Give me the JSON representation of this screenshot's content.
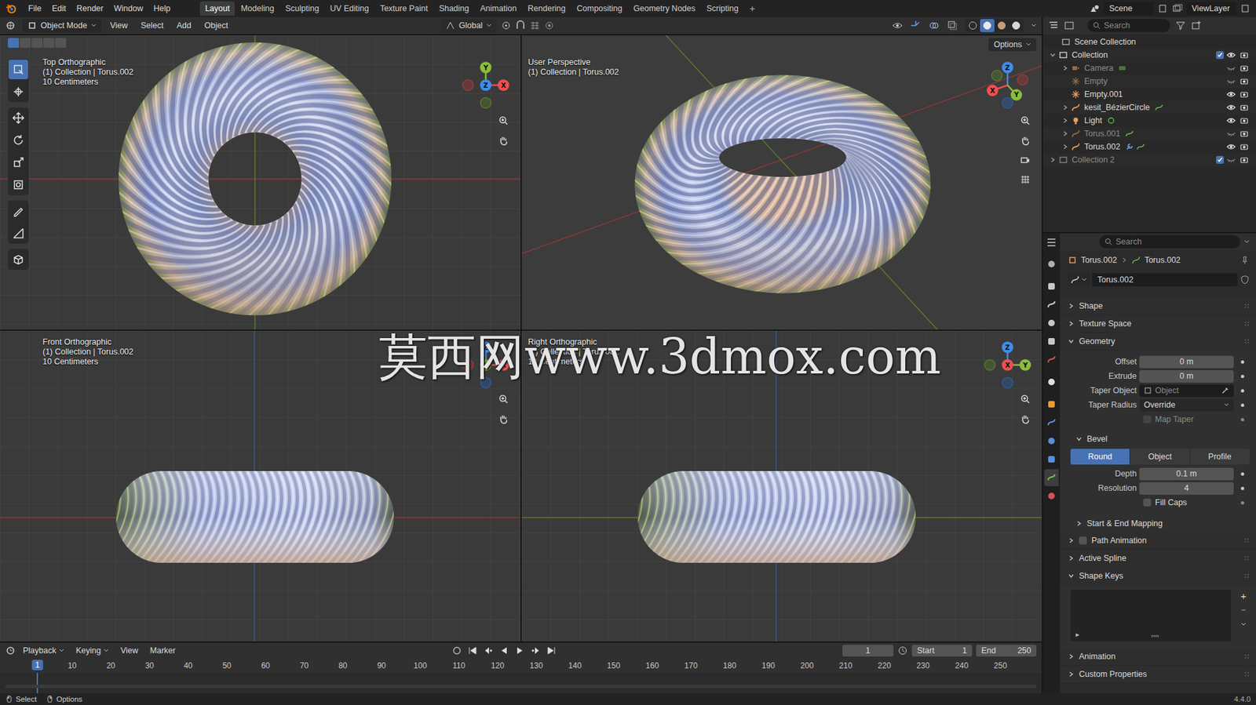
{
  "topbar": {
    "menus": [
      "File",
      "Edit",
      "Render",
      "Window",
      "Help"
    ],
    "workspaces": [
      {
        "label": "Layout",
        "selected": true
      },
      {
        "label": "Modeling",
        "selected": false
      },
      {
        "label": "Sculpting",
        "selected": false
      },
      {
        "label": "UV Editing",
        "selected": false
      },
      {
        "label": "Texture Paint",
        "selected": false
      },
      {
        "label": "Shading",
        "selected": false
      },
      {
        "label": "Animation",
        "selected": false
      },
      {
        "label": "Rendering",
        "selected": false
      },
      {
        "label": "Compositing",
        "selected": false
      },
      {
        "label": "Geometry Nodes",
        "selected": false
      },
      {
        "label": "Scripting",
        "selected": false
      }
    ],
    "add_workspace": "+",
    "scene": "Scene",
    "view_layer": "ViewLayer"
  },
  "viewport_header": {
    "mode": "Object Mode",
    "menus": [
      "View",
      "Select",
      "Add",
      "Object"
    ],
    "orientation": "Global",
    "options": "Options",
    "shading": [
      {
        "selected": false
      },
      {
        "selected": true
      },
      {
        "selected": false
      },
      {
        "selected": false
      }
    ]
  },
  "toolbar": [
    {
      "selected": true
    },
    {
      "selected": false
    },
    {
      "selected": false
    },
    {
      "selected": false
    },
    {
      "selected": false
    },
    {
      "selected": false
    },
    {
      "selected": false
    },
    {
      "selected": false
    },
    {
      "selected": false
    }
  ],
  "viewports": [
    {
      "kind": "top",
      "title": "Top Orthographic",
      "context": "(1) Collection | Torus.002",
      "scale": "10 Centimeters",
      "gizmo": [
        {
          "label": "",
          "color": "#9c3a3a",
          "dir": "left"
        },
        {
          "label": "",
          "color": "#55782c",
          "dir": "down"
        },
        {
          "label": "Y",
          "color": "#8bbd3c",
          "dir": "up"
        },
        {
          "label": "X",
          "color": "#f0504f",
          "dir": "right"
        },
        {
          "label": "Z",
          "color": "#3f8ded",
          "dir": "center"
        }
      ]
    },
    {
      "kind": "persp",
      "title": "User Perspective",
      "context": "(1) Collection | Torus.002",
      "gizmo": [
        {
          "label": "",
          "color": "#9c3a3a",
          "dir": "up-right"
        },
        {
          "label": "",
          "color": "#55782c",
          "dir": "up-left"
        },
        {
          "label": "",
          "color": "#2c5a9c",
          "dir": "down"
        },
        {
          "label": "Z",
          "color": "#3f8ded",
          "dir": "up"
        },
        {
          "label": "X",
          "color": "#f0504f",
          "dir": "down-left"
        },
        {
          "label": "Y",
          "color": "#8bbd3c",
          "dir": "down-right"
        }
      ]
    },
    {
      "kind": "front",
      "title": "Front Orthographic",
      "context": "(1) Collection | Torus.002",
      "scale": "10 Centimeters",
      "gizmo": [
        {
          "label": "",
          "color": "#9c3a3a",
          "dir": "left"
        },
        {
          "label": "",
          "color": "#2c5a9c",
          "dir": "down"
        },
        {
          "label": "Z",
          "color": "#3f8ded",
          "dir": "up"
        },
        {
          "label": "X",
          "color": "#f0504f",
          "dir": "right"
        },
        {
          "label": "Y",
          "color": "#8bbd3c",
          "dir": "center"
        }
      ]
    },
    {
      "kind": "right",
      "title": "Right Orthographic",
      "context": "(1) Collection | Torus.002",
      "scale": "10 Centimeters",
      "gizmo": [
        {
          "label": "",
          "color": "#55782c",
          "dir": "left"
        },
        {
          "label": "",
          "color": "#2c5a9c",
          "dir": "down"
        },
        {
          "label": "Z",
          "color": "#3f8ded",
          "dir": "up"
        },
        {
          "label": "Y",
          "color": "#8bbd3c",
          "dir": "right"
        },
        {
          "label": "X",
          "color": "#f0504f",
          "dir": "center"
        }
      ]
    }
  ],
  "watermark": "莫西网www.3dmox.com",
  "outliner": {
    "search": "Search",
    "root": "Scene Collection",
    "items": [
      {
        "name": "Collection",
        "depth": 0,
        "kind": "collection",
        "has_children": true,
        "expanded": true,
        "checked": true,
        "visible": true,
        "dimmed": false,
        "modifiers": false
      },
      {
        "name": "Camera",
        "depth": 1,
        "kind": "camera",
        "has_children": true,
        "expanded": false,
        "visible": false,
        "dimmed": true,
        "modifiers": false
      },
      {
        "name": "Empty",
        "depth": 1,
        "kind": "empty",
        "has_children": false,
        "expanded": false,
        "visible": false,
        "dimmed": true,
        "modifiers": false
      },
      {
        "name": "Empty.001",
        "depth": 1,
        "kind": "empty",
        "has_children": false,
        "expanded": false,
        "visible": true,
        "dimmed": false,
        "modifiers": false
      },
      {
        "name": "kesit_BézierCircle",
        "depth": 1,
        "kind": "curve",
        "has_children": true,
        "expanded": false,
        "visible": true,
        "dimmed": false,
        "modifiers": false
      },
      {
        "name": "Light",
        "depth": 1,
        "kind": "light",
        "has_children": true,
        "expanded": false,
        "visible": true,
        "dimmed": false,
        "modifiers": false
      },
      {
        "name": "Torus.001",
        "depth": 1,
        "kind": "curve",
        "has_children": true,
        "expanded": false,
        "visible": false,
        "dimmed": true,
        "modifiers": false
      },
      {
        "name": "Torus.002",
        "depth": 1,
        "kind": "curve",
        "has_children": true,
        "expanded": false,
        "visible": true,
        "dimmed": false,
        "modifiers": true
      },
      {
        "name": "Collection 2",
        "depth": 0,
        "kind": "collection",
        "has_children": true,
        "expanded": false,
        "checked": true,
        "visible": false,
        "dimmed": true,
        "modifiers": false
      }
    ]
  },
  "properties": {
    "search": "Search",
    "tabs": [
      {
        "selected": false
      },
      {
        "selected": false
      },
      {
        "selected": false
      },
      {
        "selected": false
      },
      {
        "selected": false
      },
      {
        "selected": false
      },
      {
        "selected": false
      },
      {
        "selected": false
      },
      {
        "selected": false
      },
      {
        "selected": false
      },
      {
        "selected": false
      },
      {
        "selected": true
      },
      {
        "selected": false
      }
    ],
    "breadcrumb": [
      "Torus.002",
      "Torus.002"
    ],
    "datablock": "Torus.002",
    "panels": [
      {
        "label": "Shape",
        "kind": "plain",
        "expanded": false
      },
      {
        "label": "Texture Space",
        "kind": "plain",
        "expanded": false
      },
      {
        "label": "Geometry",
        "kind": "geometry",
        "expanded": true
      },
      {
        "label": "Path Animation",
        "kind": "checkbox",
        "expanded": false,
        "checked": false
      },
      {
        "label": "Active Spline",
        "kind": "plain",
        "expanded": false
      },
      {
        "label": "Shape Keys",
        "kind": "list",
        "expanded": true
      },
      {
        "label": "Animation",
        "kind": "plain",
        "expanded": false
      },
      {
        "label": "Custom Properties",
        "kind": "plain",
        "expanded": false
      }
    ],
    "geometry": {
      "fields": [
        {
          "label": "Offset",
          "value": "0 m",
          "kind": "number"
        },
        {
          "label": "Extrude",
          "value": "0 m",
          "kind": "number"
        },
        {
          "label": "Taper Object",
          "value": "Object",
          "kind": "object"
        },
        {
          "label": "Taper Radius",
          "value": "Override",
          "kind": "dropdown"
        },
        {
          "label": "Map Taper",
          "kind": "checkbox",
          "checked": false,
          "disabled": true
        }
      ],
      "bevel": {
        "label": "Bevel",
        "expanded": true,
        "modes": [
          {
            "label": "Round",
            "selected": true
          },
          {
            "label": "Object",
            "selected": false
          },
          {
            "label": "Profile",
            "selected": false
          }
        ],
        "fields": [
          {
            "label": "Depth",
            "value": "0.1 m",
            "kind": "number"
          },
          {
            "label": "Resolution",
            "value": "4",
            "kind": "number"
          },
          {
            "label": "Fill Caps",
            "kind": "checkbox",
            "checked": false,
            "disabled": false
          }
        ]
      },
      "subpanels": [
        {
          "label": "Start & End Mapping",
          "expanded": false
        }
      ]
    },
    "shape_keys": {
      "add": "+",
      "filter": "▸"
    }
  },
  "timeline": {
    "menus": [
      "Playback",
      "Keying",
      "View",
      "Marker"
    ],
    "frame": "1",
    "start_label": "Start",
    "start": "1",
    "end_label": "End",
    "end": "250",
    "current": "1",
    "ticks": [
      "10",
      "20",
      "30",
      "40",
      "50",
      "60",
      "70",
      "80",
      "90",
      "100",
      "110",
      "120",
      "130",
      "140",
      "150",
      "160",
      "170",
      "180",
      "190",
      "200",
      "210",
      "220",
      "230",
      "240",
      "250"
    ]
  },
  "status_bar": {
    "items": [
      "Select",
      "Options"
    ],
    "version": "4.4.0"
  }
}
